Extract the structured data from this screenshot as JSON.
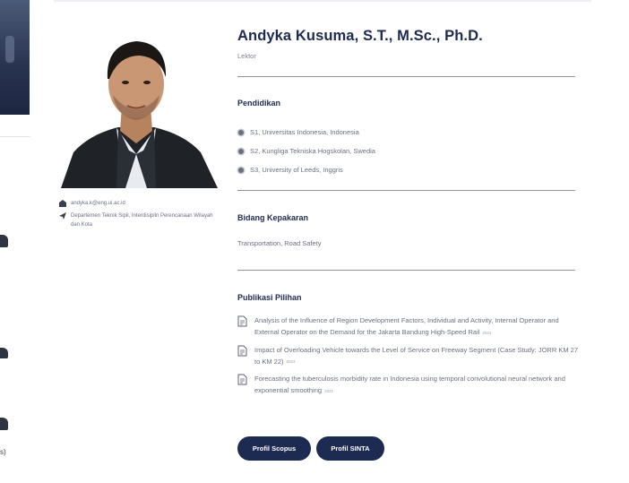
{
  "profile": {
    "name": "Andyka Kusuma, S.T., M.Sc., Ph.D.",
    "position": "Lektor",
    "email": "andyka.k@eng.ui.ac.id",
    "department": "Departemen Teknik Sipil, Interdisiplin Perencanaan Wilayah dan Kota"
  },
  "education": {
    "title": "Pendidikan",
    "items": [
      "S1, Universitas Indonesia, Indonesia",
      "S2, Kungliga Tekniska Hogskolan, Swedia",
      "S3, University of Leeds, Inggris"
    ]
  },
  "expertise": {
    "title": "Bidang Kepakaran",
    "text": "Transportation, Road Safety"
  },
  "publications": {
    "title": "Publikasi Pilihan",
    "items": [
      {
        "title": "Analysis of the Influence of Region Development Factors, Individual and Activity, Internal Operator and External Operator on the Demand for the Jakarta Bandung High-Speed Rail",
        "year": "2023"
      },
      {
        "title": "Impact of Overloading Vehicle towards the Level of Service on Freeway Segment (Case Study: JORR KM 27 to KM 22)",
        "year": "2023"
      },
      {
        "title": "Forecasting the tuberculosis morbidity rate in Indonesia using temporal convolutional neural network and exponential smoothing",
        "year": "2021"
      }
    ]
  },
  "buttons": {
    "scopus": "Profil Scopus",
    "sinta": "Profil SINTA"
  },
  "left_strip": {
    "fragment": "s)"
  },
  "colors": {
    "navy": "#1d2a52",
    "text_gray": "#6b7080",
    "rule": "#8f939c"
  },
  "icons": {
    "email": "envelope-icon",
    "department": "location-pin-icon",
    "education_bullet": "bullet-dot-icon",
    "publication": "document-icon"
  }
}
